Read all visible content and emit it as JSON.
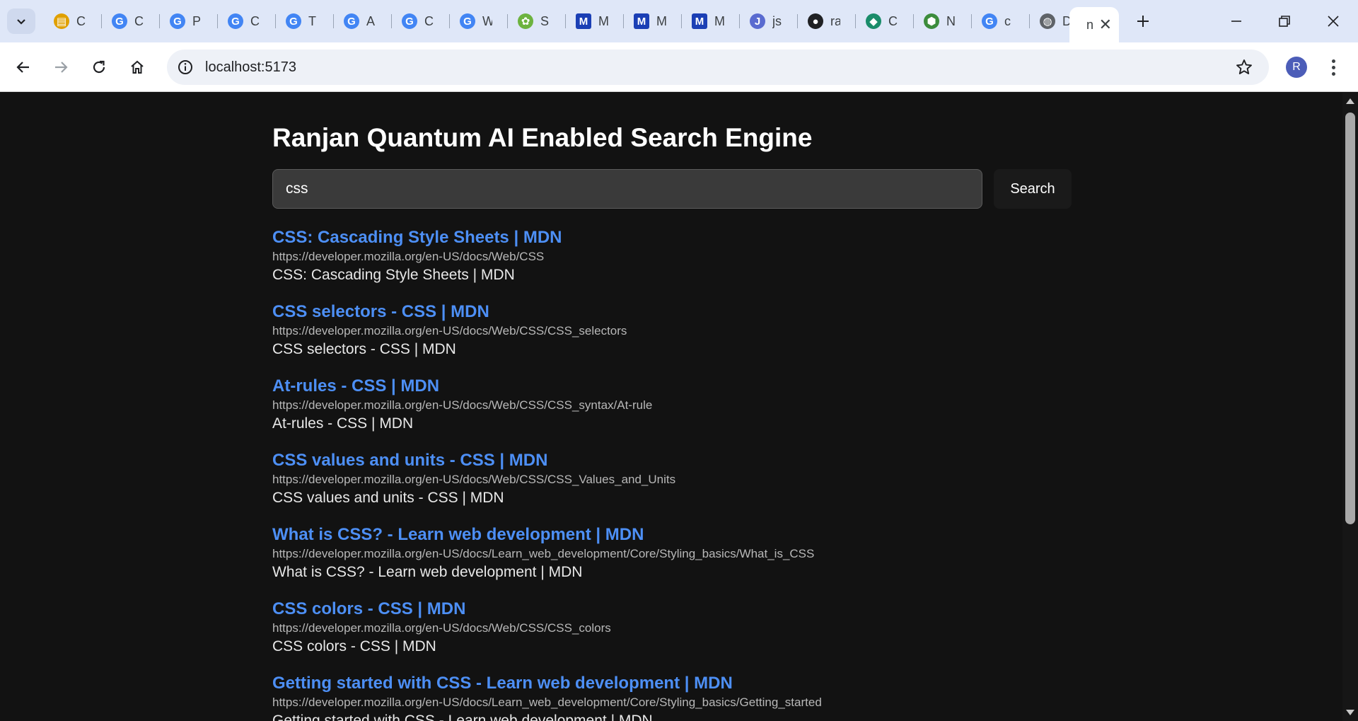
{
  "browser": {
    "tabs": [
      {
        "title": "C",
        "icon": "file-icon",
        "color": "#e0a000"
      },
      {
        "title": "C",
        "icon": "google-icon",
        "color": "#4285f4"
      },
      {
        "title": "P",
        "icon": "google-icon",
        "color": "#4285f4"
      },
      {
        "title": "C",
        "icon": "google-icon",
        "color": "#4285f4"
      },
      {
        "title": "T",
        "icon": "google-icon",
        "color": "#4285f4"
      },
      {
        "title": "A",
        "icon": "google-icon",
        "color": "#4285f4"
      },
      {
        "title": "C",
        "icon": "google-icon",
        "color": "#4285f4"
      },
      {
        "title": "W",
        "icon": "google-icon",
        "color": "#4285f4"
      },
      {
        "title": "S",
        "icon": "spring-icon",
        "color": "#6db33f"
      },
      {
        "title": "M",
        "icon": "mdn-icon",
        "color": "#1b3fb5"
      },
      {
        "title": "M",
        "icon": "mdn-icon",
        "color": "#1b3fb5"
      },
      {
        "title": "M",
        "icon": "mdn-icon",
        "color": "#1b3fb5"
      },
      {
        "title": "js",
        "icon": "javascript-icon",
        "color": "#5a6bd0"
      },
      {
        "title": "ra",
        "icon": "github-icon",
        "color": "#202124"
      },
      {
        "title": "C",
        "icon": "mongodb-icon",
        "color": "#1a8c6a"
      },
      {
        "title": "N",
        "icon": "nodejs-icon",
        "color": "#3c8c3c"
      },
      {
        "title": "c",
        "icon": "google-icon",
        "color": "#4285f4"
      },
      {
        "title": "D",
        "icon": "globe-icon",
        "color": "#5f6368"
      }
    ],
    "active_tab": {
      "title": "n"
    },
    "url": "localhost:5173",
    "profile_initial": "R",
    "avatar_color": "#4c5db8"
  },
  "page": {
    "title": "Ranjan Quantum AI Enabled Search Engine",
    "search": {
      "value": "css",
      "button_label": "Search"
    },
    "results": [
      {
        "title": "CSS: Cascading Style Sheets | MDN",
        "url": "https://developer.mozilla.org/en-US/docs/Web/CSS",
        "description": "CSS: Cascading Style Sheets | MDN"
      },
      {
        "title": "CSS selectors - CSS | MDN",
        "url": "https://developer.mozilla.org/en-US/docs/Web/CSS/CSS_selectors",
        "description": "CSS selectors - CSS | MDN"
      },
      {
        "title": "At-rules - CSS | MDN",
        "url": "https://developer.mozilla.org/en-US/docs/Web/CSS/CSS_syntax/At-rule",
        "description": "At-rules - CSS | MDN"
      },
      {
        "title": "CSS values and units - CSS | MDN",
        "url": "https://developer.mozilla.org/en-US/docs/Web/CSS/CSS_Values_and_Units",
        "description": "CSS values and units - CSS | MDN"
      },
      {
        "title": "What is CSS? - Learn web development | MDN",
        "url": "https://developer.mozilla.org/en-US/docs/Learn_web_development/Core/Styling_basics/What_is_CSS",
        "description": "What is CSS? - Learn web development | MDN"
      },
      {
        "title": "CSS colors - CSS | MDN",
        "url": "https://developer.mozilla.org/en-US/docs/Web/CSS/CSS_colors",
        "description": "CSS colors - CSS | MDN"
      },
      {
        "title": "Getting started with CSS - Learn web development | MDN",
        "url": "https://developer.mozilla.org/en-US/docs/Learn_web_development/Core/Styling_basics/Getting_started",
        "description": "Getting started with CSS - Learn web development | MDN"
      }
    ]
  },
  "colors": {
    "page_bg": "#121212",
    "link": "#4d8ff5",
    "tabstrip_bg": "#dfe7f8"
  }
}
